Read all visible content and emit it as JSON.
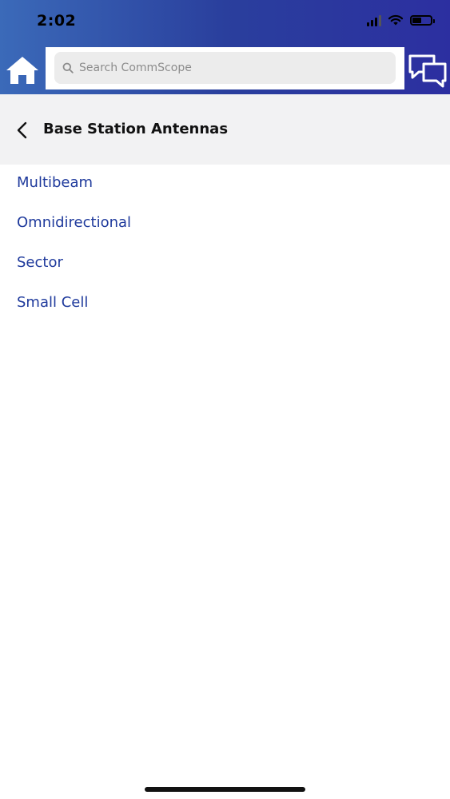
{
  "status_bar": {
    "time": "2:02"
  },
  "header": {
    "home_icon": "home-icon",
    "search": {
      "placeholder": "Search CommScope",
      "value": ""
    },
    "chat_icon": "chat-bubbles-icon"
  },
  "page": {
    "title": "Base Station Antennas",
    "back_icon": "chevron-left-icon"
  },
  "categories": [
    {
      "label": "Multibeam"
    },
    {
      "label": "Omnidirectional"
    },
    {
      "label": "Sector"
    },
    {
      "label": "Small Cell"
    }
  ],
  "colors": {
    "header_gradient_start": "#3b6ab9",
    "header_gradient_end": "#2c2fa0",
    "link": "#1f3a9c",
    "title_bar_bg": "#f2f2f3",
    "search_bg": "#ececec"
  }
}
